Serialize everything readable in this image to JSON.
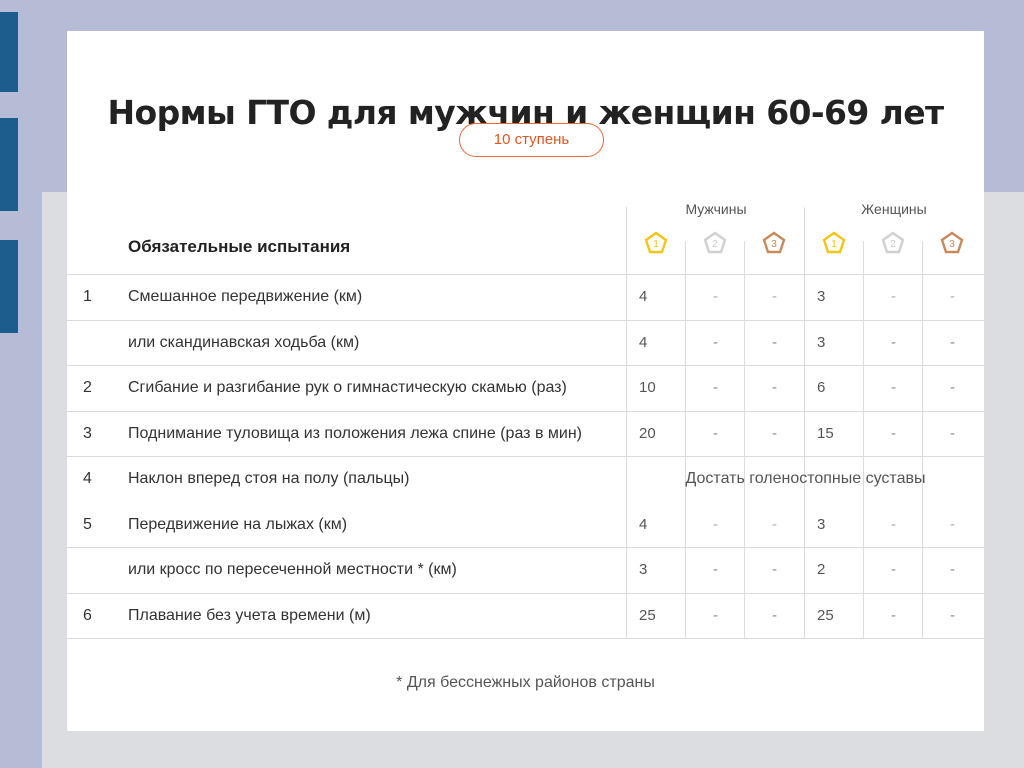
{
  "title": "Нормы ГТО для мужчин и женщин 60-69 лет",
  "stage_label": "10 ступень",
  "header": {
    "label": "Обязательные испытания",
    "groups": [
      "Мужчины",
      "Женщины"
    ],
    "medals": [
      {
        "digit": "1",
        "color": "#f3c517",
        "stroke": "#f3c517",
        "text": "#f3c517"
      },
      {
        "digit": "2",
        "color": "#d0d0d0",
        "stroke": "#c8c8c8",
        "text": "#c8c8c8"
      },
      {
        "digit": "3",
        "color": "#c98a5b",
        "stroke": "#c98a5b",
        "text": "#c98a5b"
      }
    ]
  },
  "rows": [
    {
      "num": "1",
      "name": "Смешанное передвижение (км)",
      "values": [
        "4",
        "-",
        "-",
        "3",
        "-",
        "-"
      ]
    },
    {
      "num": "",
      "name": "или скандинавская ходьба (км)",
      "values": [
        "4",
        "-",
        "-",
        "3",
        "-",
        "-"
      ]
    },
    {
      "num": "2",
      "name": "Сгибание и разгибание рук о гимнастическую скамью (раз)",
      "values": [
        "10",
        "-",
        "-",
        "6",
        "-",
        "-"
      ]
    },
    {
      "num": "3",
      "name": "Поднимание туловища из положения лежа спине (раз в мин)",
      "values": [
        "20",
        "-",
        "-",
        "15",
        "-",
        "-"
      ]
    },
    {
      "num": "4",
      "name": "Наклон вперед стоя на полу (пальцы)",
      "merged": "Достать голеностопные суставы"
    },
    {
      "num": "5",
      "name": "Передвижение на лыжах (км)",
      "values": [
        "4",
        "-",
        "-",
        "3",
        "-",
        "-"
      ]
    },
    {
      "num": "",
      "name": "или кросс по пересеченной местности * (км)",
      "values": [
        "3",
        "-",
        "-",
        "2",
        "-",
        "-"
      ]
    },
    {
      "num": "6",
      "name": "Плавание без учета времени (м)",
      "values": [
        "25",
        "-",
        "-",
        "25",
        "-",
        "-"
      ]
    }
  ],
  "footnote": "* Для бесснежных районов страны",
  "colors": {
    "accent_orange": "#e66a34",
    "gold": "#f3c517",
    "silver": "#d0d0d0",
    "bronze": "#c98a5b",
    "frame_blue": "#b6bcd6",
    "side_bar": "#1d5d8e"
  }
}
